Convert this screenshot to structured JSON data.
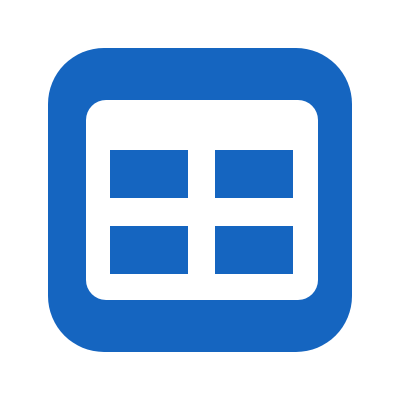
{
  "icon": {
    "name": "grid-layout-icon",
    "colors": {
      "tile": "#1565c0",
      "panel": "#ffffff",
      "cells": "#1565c0",
      "background": "#ffffff"
    }
  }
}
